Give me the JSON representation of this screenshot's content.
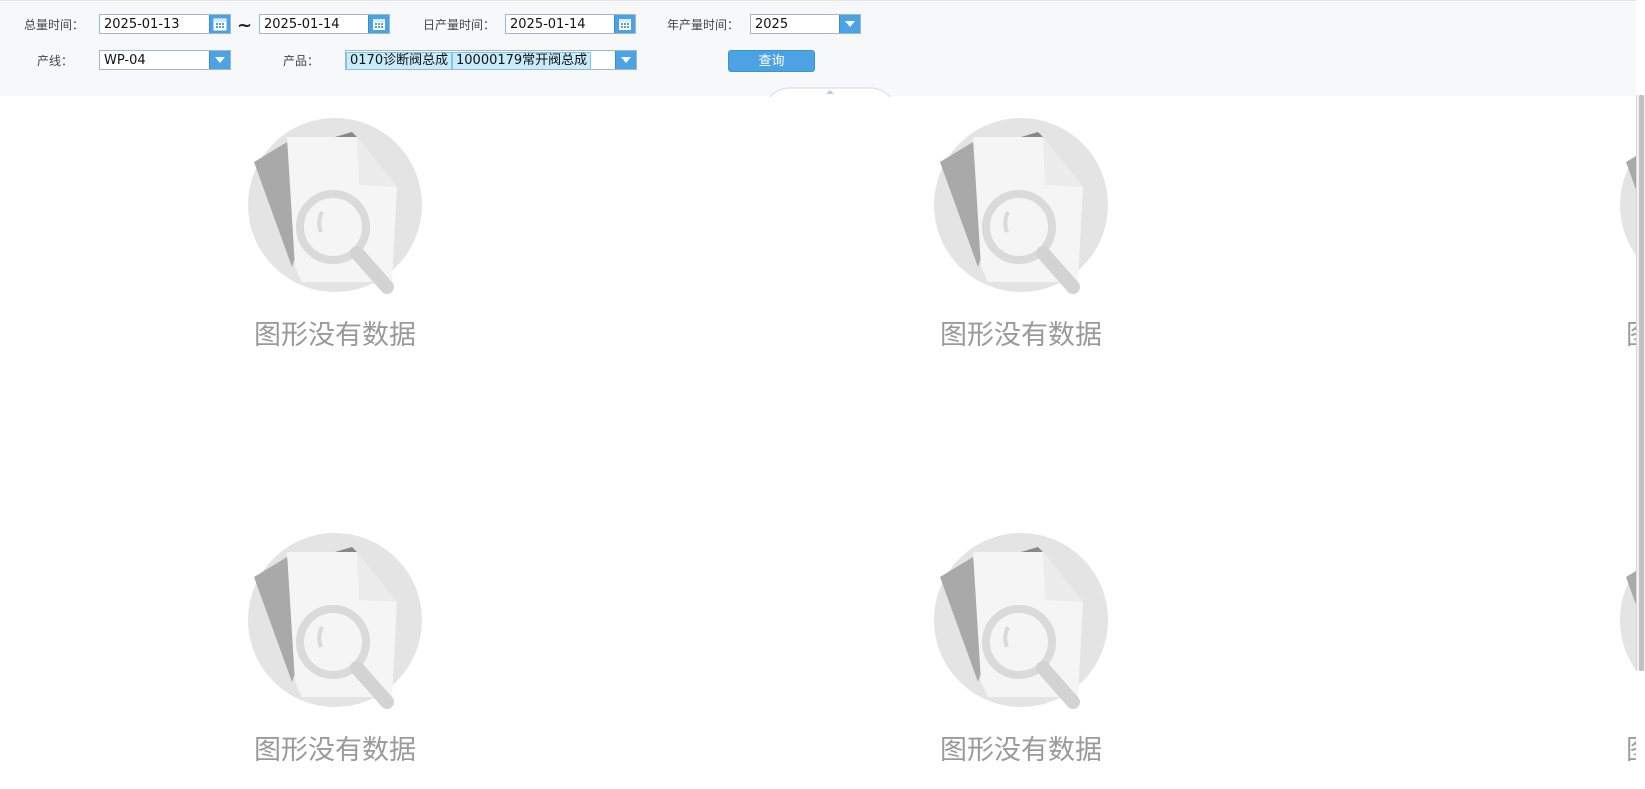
{
  "filters": {
    "total_time": {
      "label": "总量时间：",
      "start": "2025-01-13",
      "end": "2025-01-14",
      "separator": "~"
    },
    "daily_time": {
      "label": "日产量时间：",
      "value": "2025-01-14"
    },
    "year_time": {
      "label": "年产量时间：",
      "value": "2025"
    },
    "line": {
      "label": "产线：",
      "value": "WP-04"
    },
    "product": {
      "label": "产品：",
      "tags": [
        "0170诊断阀总成",
        "10000179常开阀总成"
      ]
    },
    "query_label": "查询"
  },
  "icons": {
    "calendar": "calendar-icon",
    "dropdown": "chevron-down-icon",
    "nodata": "no-data-illustration"
  },
  "panels": {
    "nodata_text": "图形没有数据",
    "items": [
      {
        "text": "图形没有数据"
      },
      {
        "text": "图形没有数据"
      },
      {
        "text": "图形没有数据"
      },
      {
        "text": "图形没有数据"
      },
      {
        "text": "图形没有数据"
      },
      {
        "text": "图形没有数据"
      }
    ]
  },
  "colors": {
    "accent": "#4ba3e3",
    "tag_bg": "#c9ecfb",
    "nodata_gray": "#9a9a9a"
  }
}
